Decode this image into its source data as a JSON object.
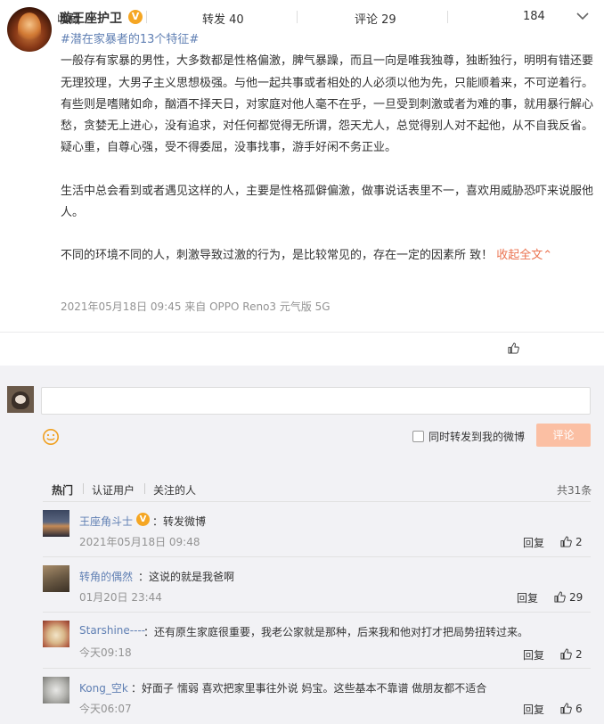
{
  "post": {
    "author": "璇王座护卫",
    "hashtag": "#潜在家暴者的13个特征#",
    "para1": "一般存有家暴的男性，大多数都是性格偏激，脾气暴躁，而且一向是唯我独尊，独断独行，明明有错还要无理狡理，大男子主义思想极强。与他一起共事或者相处的人必须以他为先，只能顺着来，不可逆着行。有些则是嗜赌如命，酗酒不择天日，对家庭对他人毫不在乎，一旦受到刺激或者为难的事，就用暴行解心愁，贪婪无上进心，没有追求，对任何都觉得无所谓，怨天尤人，总觉得别人对不起他，从不自我反省。疑心重，自尊心强，受不得委屈，没事找事，游手好闲不务正业。",
    "para2": "生活中总会看到或者遇见这样的人，主要是性格孤僻偏激，做事说话表里不一，喜欢用威胁恐吓来说服他人。",
    "para3": "不同的环境不同的人，刺激导致过激的行为，是比较常见的，存在一定的因素所 致！",
    "collapse": "收起全文",
    "meta": "2021年05月18日 09:45  来自 OPPO Reno3 元气版 5G"
  },
  "actions": {
    "favorite": "收藏",
    "repost": "转发 40",
    "comment": "评论 29",
    "like": "184"
  },
  "composer": {
    "repost_label": "同时转发到我的微博",
    "submit": "评论"
  },
  "filters": {
    "hot": "热门",
    "verified": "认证用户",
    "following": "关注的人",
    "total": "共31条"
  },
  "comments": [
    {
      "name": "王座角斗士",
      "text": "：转发微博",
      "time": "2021年05月18日 09:48",
      "reply": "回复",
      "likes": "2"
    },
    {
      "name": "转角的偶然",
      "text": "：这说的就是我爸啊",
      "time": "01月20日 23:44",
      "reply": "回复",
      "likes": "29"
    },
    {
      "name": "Starshine----",
      "text": "：还有原生家庭很重要，我老公家就是那种，后来我和他对打才把局势扭转过来。",
      "time": "今天09:18",
      "reply": "回复",
      "likes": "2"
    },
    {
      "name": "Kong_空k",
      "text": "：好面子 懦弱 喜欢把家里事往外说 妈宝。这些基本不靠谱 做朋友都不适合",
      "time": "今天06:07",
      "reply": "回复",
      "likes": "6"
    }
  ],
  "colors": {
    "link": "#5f7fb3",
    "accent": "#eb7350",
    "badge": "#f5a623",
    "submit": "#fbbfa3"
  }
}
